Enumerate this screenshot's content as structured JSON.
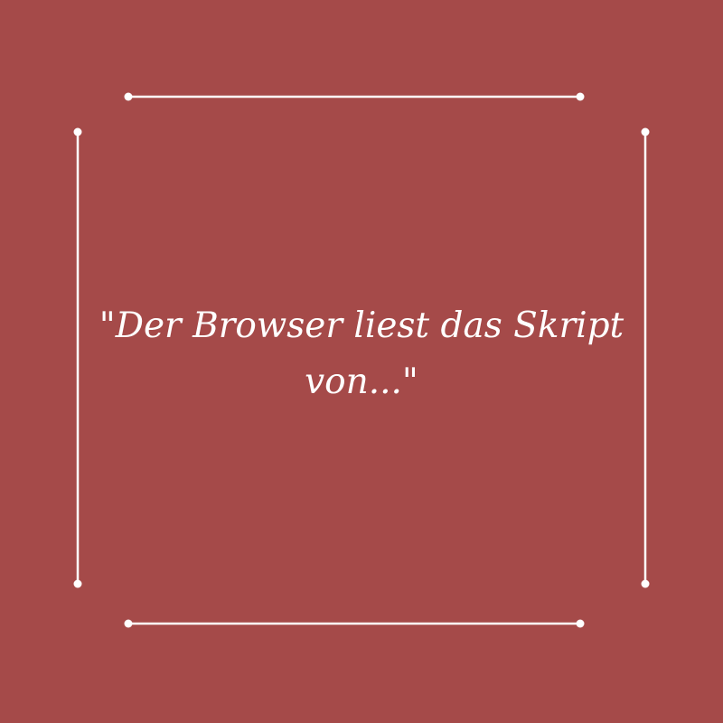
{
  "background_color": "#a54a49",
  "line_color": "#ffffff",
  "quote": {
    "text": "\"Der Browser liest das Skript von...\""
  },
  "frame": {
    "lines": [
      {
        "name": "frame-top-line"
      },
      {
        "name": "frame-bottom-line"
      },
      {
        "name": "frame-left-line"
      },
      {
        "name": "frame-right-line"
      }
    ]
  }
}
